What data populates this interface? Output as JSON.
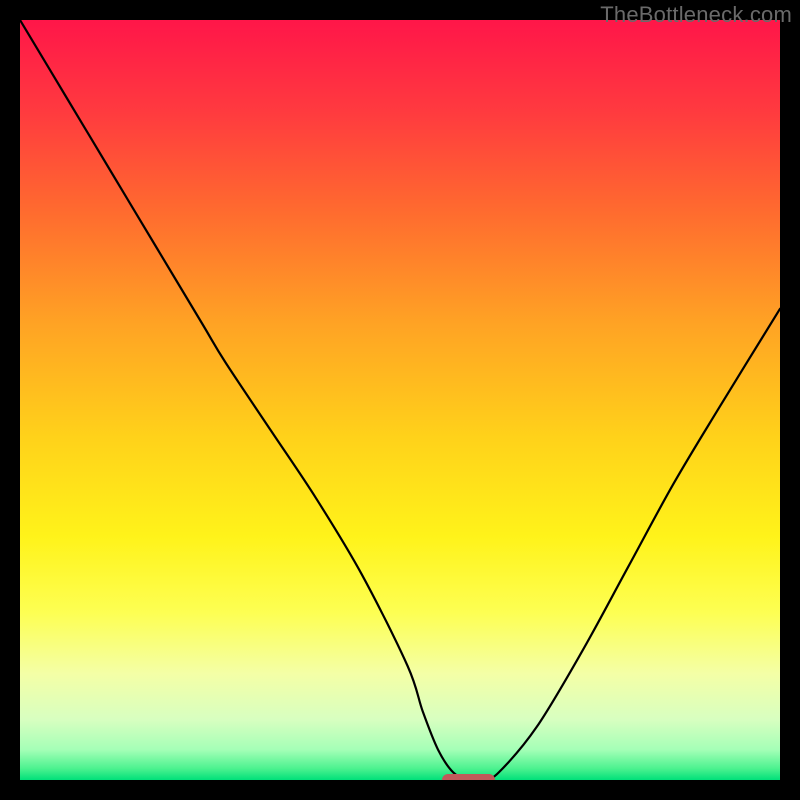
{
  "watermark": "TheBottleneck.com",
  "colors": {
    "black": "#000000",
    "curve": "#000000",
    "marker": "#c05a5a",
    "watermark": "#6a6a6a"
  },
  "gradient_stops": [
    {
      "offset": 0.0,
      "color": "#ff1649"
    },
    {
      "offset": 0.12,
      "color": "#ff3a3f"
    },
    {
      "offset": 0.25,
      "color": "#ff6a2f"
    },
    {
      "offset": 0.4,
      "color": "#ffa324"
    },
    {
      "offset": 0.55,
      "color": "#ffd21a"
    },
    {
      "offset": 0.68,
      "color": "#fff31a"
    },
    {
      "offset": 0.78,
      "color": "#fdff53"
    },
    {
      "offset": 0.86,
      "color": "#f4ffa6"
    },
    {
      "offset": 0.92,
      "color": "#d8ffc0"
    },
    {
      "offset": 0.96,
      "color": "#a5ffb7"
    },
    {
      "offset": 0.985,
      "color": "#4cf28f"
    },
    {
      "offset": 1.0,
      "color": "#00e07a"
    }
  ],
  "chart_data": {
    "type": "line",
    "title": "",
    "xlabel": "",
    "ylabel": "",
    "xlim": [
      0,
      100
    ],
    "ylim": [
      0,
      100
    ],
    "grid": false,
    "series": [
      {
        "name": "bottleneck-curve",
        "x": [
          0,
          6,
          12,
          18,
          24,
          27,
          33,
          39,
          45,
          51,
          53,
          55,
          57,
          59,
          61,
          63,
          68,
          74,
          80,
          86,
          92,
          100
        ],
        "y": [
          100,
          90,
          80,
          70,
          60,
          55,
          46,
          37,
          27,
          15,
          9,
          4,
          1,
          0,
          0,
          1,
          7,
          17,
          28,
          39,
          49,
          62
        ]
      }
    ],
    "annotations": [
      {
        "name": "optimal-marker",
        "x": 59,
        "y": 0,
        "width_frac": 0.07,
        "height_frac": 0.015
      }
    ]
  }
}
